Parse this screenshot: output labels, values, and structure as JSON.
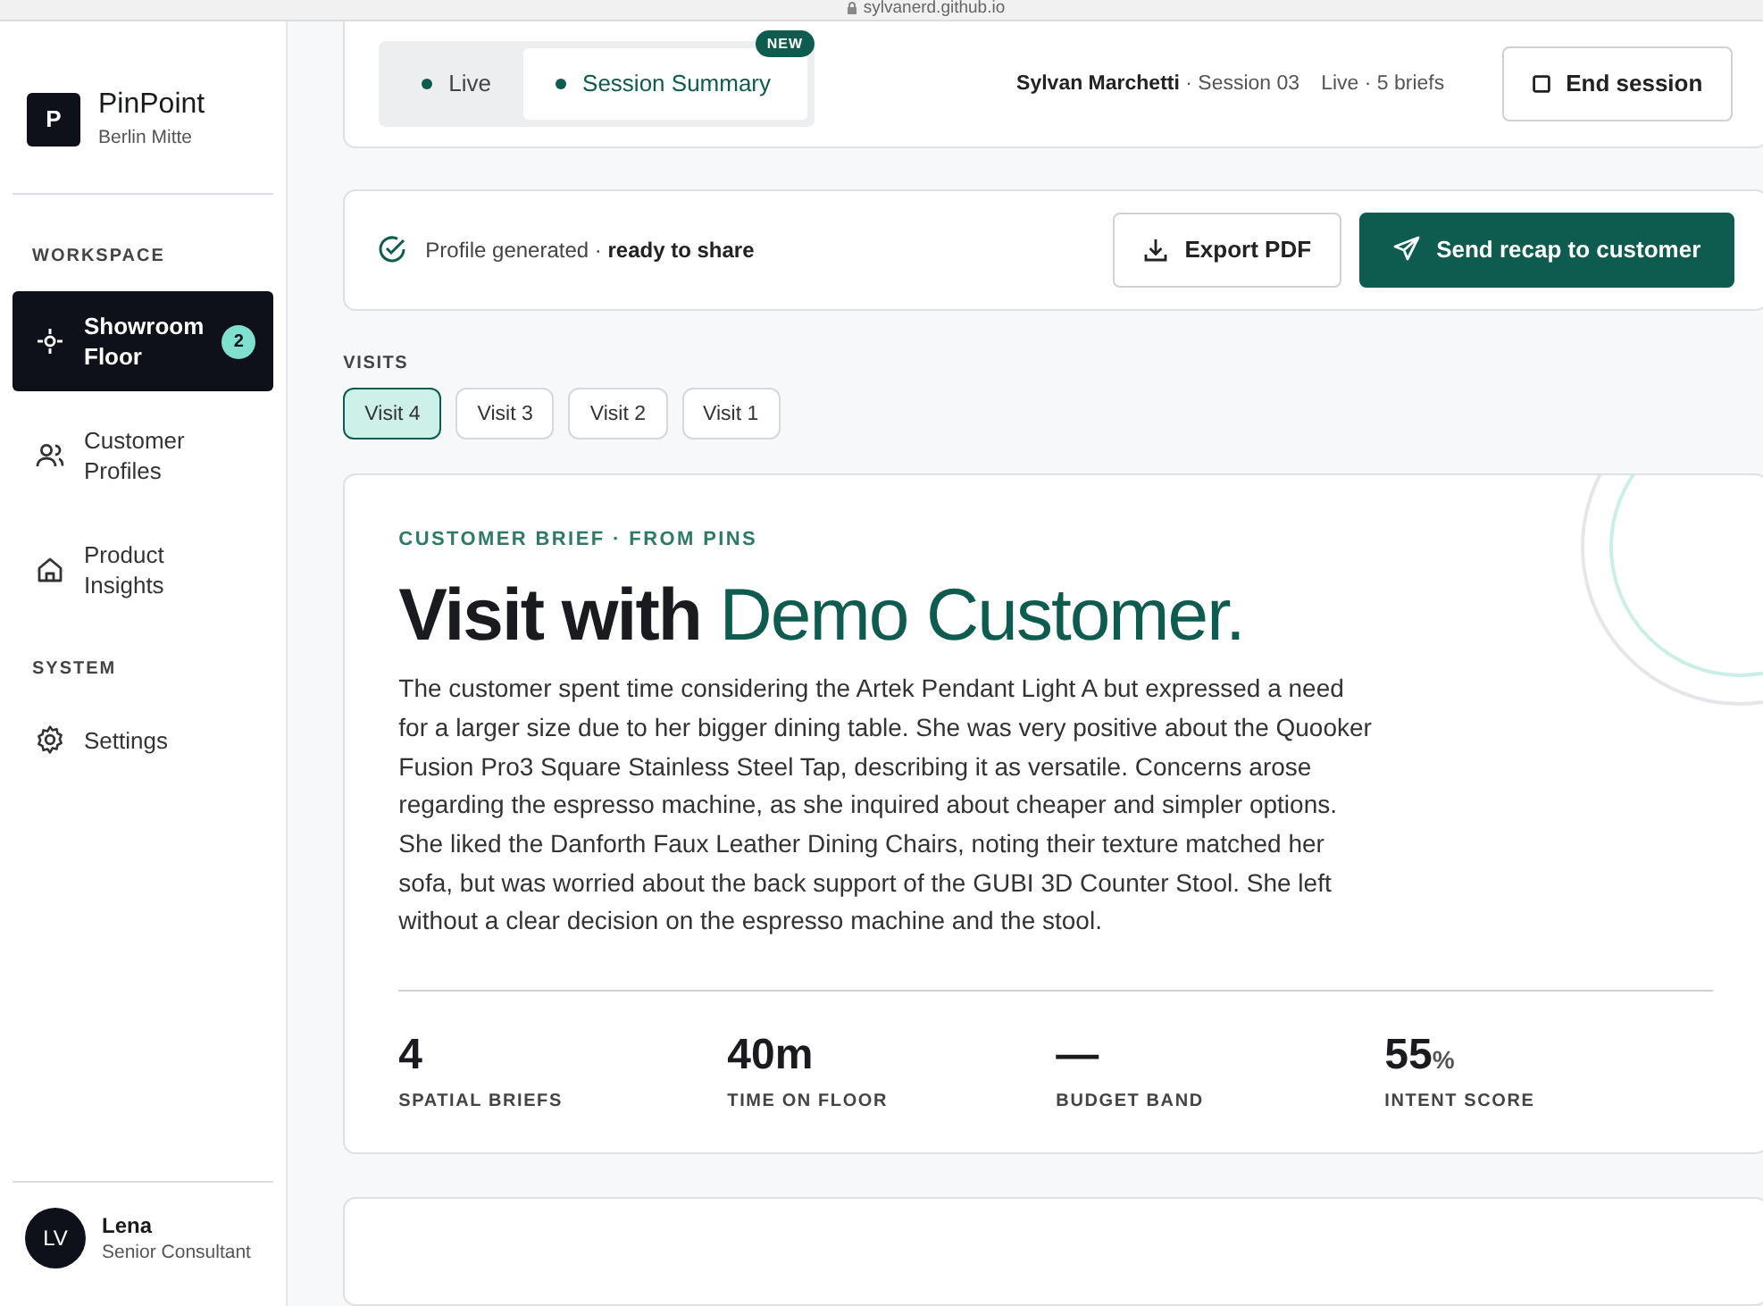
{
  "browser": {
    "url": "sylvanerd.github.io"
  },
  "brand": {
    "logo": "P",
    "name": "PinPoint",
    "location": "Berlin Mitte"
  },
  "sidebar": {
    "sections": [
      {
        "title": "WORKSPACE",
        "items": [
          {
            "label": "Showroom Floor",
            "selected": true,
            "badge": "2"
          },
          {
            "label": "Customer Profiles",
            "selected": false
          },
          {
            "label": "Product Insights",
            "selected": false
          }
        ]
      },
      {
        "title": "SYSTEM",
        "items": [
          {
            "label": "Settings",
            "selected": false
          }
        ]
      }
    ]
  },
  "user": {
    "initials": "LV",
    "name": "Lena",
    "role": "Senior Consultant"
  },
  "header": {
    "tabs": [
      {
        "label": "Live",
        "selected": false
      },
      {
        "label": "Session Summary",
        "selected": true,
        "badge": "NEW"
      }
    ],
    "session": "**Sylvan Marchetti** · Session 03",
    "status": "Live · 5 briefs",
    "end_button": "End session"
  },
  "profile_bar": {
    "status": "Profile generated · **ready to share**",
    "export_button": "Export PDF",
    "send_button": "Send recap to customer"
  },
  "visits": {
    "label": "VISITS",
    "items": [
      {
        "label": "Visit 4",
        "selected": true
      },
      {
        "label": "Visit 3",
        "selected": false
      },
      {
        "label": "Visit 2",
        "selected": false
      },
      {
        "label": "Visit 1",
        "selected": false
      }
    ]
  },
  "brief": {
    "eyebrow": "CUSTOMER BRIEF · FROM PINS",
    "title": "Visit with",
    "title_highlight": "Demo Customer.",
    "body": "The customer spent time considering the Artek Pendant Light A but expressed a need for a larger size due to her bigger dining table. She was very positive about the Quooker Fusion Pro3 Square Stainless Steel Tap, describing it as versatile. Concerns arose regarding the espresso machine, as she inquired about cheaper and simpler options. She liked the Danforth Faux Leather Dining Chairs, noting their texture matched her sofa, but was worried about the back support of the GUBI 3D Counter Stool. She left without a clear decision on the espresso machine and the stool.",
    "stats": [
      {
        "value": "4",
        "label": "SPATIAL BRIEFS"
      },
      {
        "value": "40m",
        "label": "TIME ON FLOOR"
      },
      {
        "value": "—",
        "label": "BUDGET BAND"
      },
      {
        "value": "55",
        "unit": "%",
        "label": "INTENT SCORE"
      }
    ]
  }
}
